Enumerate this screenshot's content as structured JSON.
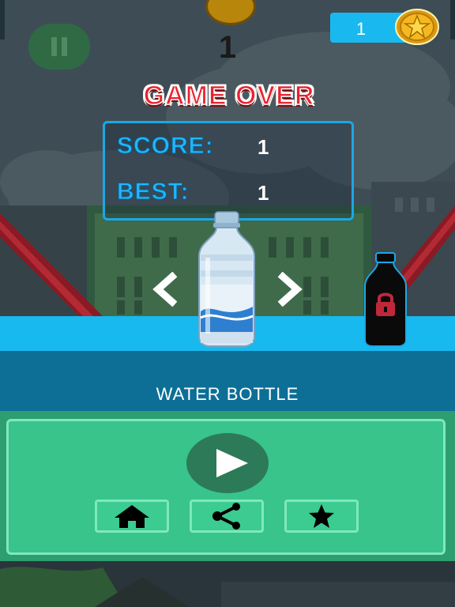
{
  "hud": {
    "current_score": "1",
    "coin_count": "1",
    "pause_icon": "pause-icon",
    "coin_icon": "star-coin-icon"
  },
  "game_over": {
    "title": "GAME OVER",
    "score_label": "SCORE:",
    "score_value": "1",
    "best_label": "BEST:",
    "best_value": "1"
  },
  "bottle_selector": {
    "selected_bottle": "WATER BOTTLE",
    "prev_icon": "chevron-left-icon",
    "next_icon": "chevron-right-icon",
    "locked_icon": "lock-icon"
  },
  "menu": {
    "play_icon": "play-icon",
    "home_icon": "home-icon",
    "share_icon": "share-icon",
    "rate_icon": "star-icon"
  },
  "colors": {
    "accent_blue": "#19b9f0",
    "menu_green": "#38c48b",
    "game_over_red": "#e8232e"
  }
}
